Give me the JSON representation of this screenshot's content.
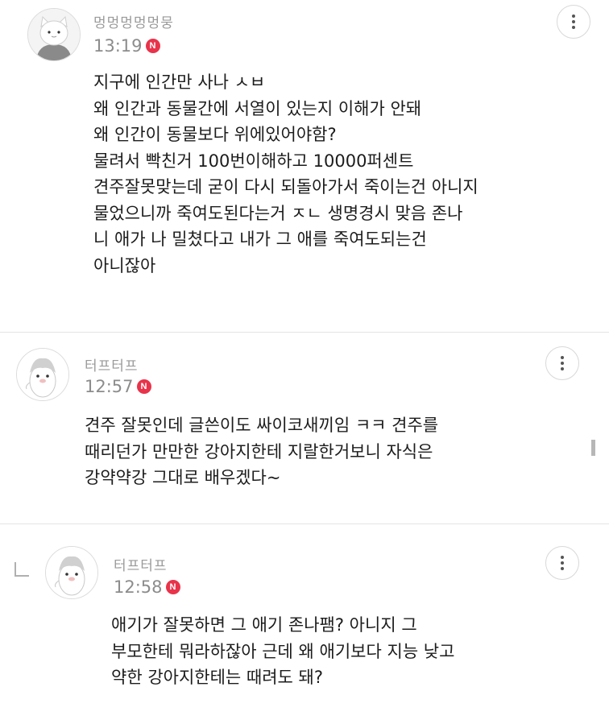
{
  "comments": [
    {
      "author": "멍멍멍멍멍뭉",
      "time": "13:19",
      "badge": "N",
      "avatar_icon": "cat-avatar-icon",
      "lines": [
        "지구에 인간만 사나 ㅅㅂ",
        "왜 인간과 동물간에 서열이 있는지 이해가 안돼",
        "왜 인간이 동물보다 위에있어야함?",
        "물려서 빡친거 100번이해하고 10000퍼센트",
        "견주잘못맞는데 굳이 다시 되돌아가서 죽이는건 아니지",
        "물었으니까 죽여도된다는거 ㅈㄴ 생명경시 맞음 존나",
        "니 애가 나 밀쳤다고 내가 그 애를 죽여도되는건",
        "아니잖아"
      ]
    },
    {
      "author": "터프터프",
      "time": "12:57",
      "badge": "N",
      "avatar_icon": "penguin-avatar-icon",
      "lines": [
        "견주 잘못인데 글쓴이도 싸이코새끼임 ㅋㅋ 견주를",
        "때리던가 만만한 강아지한테 지랄한거보니 자식은",
        "강약약강 그대로 배우겠다~"
      ]
    },
    {
      "author": "터프터프",
      "time": "12:58",
      "badge": "N",
      "avatar_icon": "penguin-avatar-icon",
      "lines": [
        "애기가 잘못하면 그 애기 존나팸? 아니지 그",
        "부모한테 뭐라하잖아 근데 왜 애기보다 지능 낮고",
        "약한 강아지한테는 때려도 돼?"
      ]
    }
  ],
  "icons": {
    "more": "more-vertical-icon",
    "reply": "reply-arrow-icon"
  },
  "colors": {
    "badge": "#e8334a",
    "author": "#9a9a9a",
    "time": "#8c8c8c",
    "text": "#1c1c1c"
  }
}
